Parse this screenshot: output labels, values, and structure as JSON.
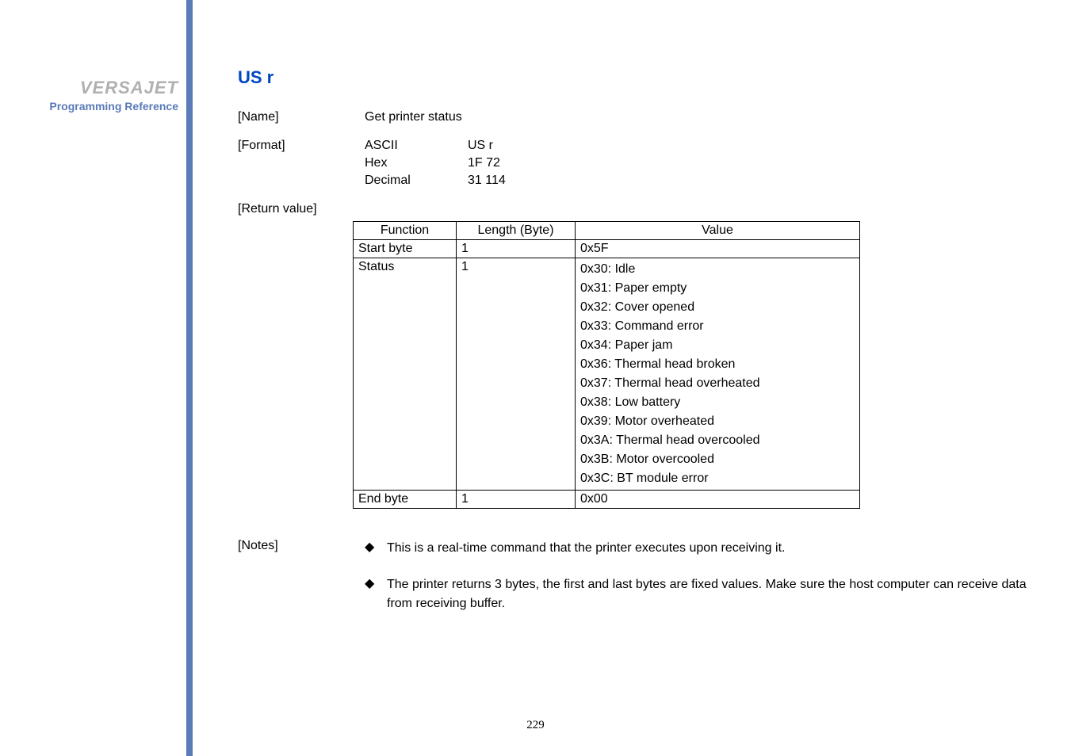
{
  "sidebar": {
    "brand": "VERSAJET",
    "subtitle": "Programming Reference"
  },
  "command": {
    "title": "US r"
  },
  "name": {
    "label": "[Name]",
    "value": "Get printer status"
  },
  "format": {
    "label": "[Format]",
    "rows": [
      {
        "enc": "ASCII",
        "val": "US r"
      },
      {
        "enc": "Hex",
        "val": "1F 72"
      },
      {
        "enc": "Decimal",
        "val": "31 114"
      }
    ]
  },
  "returnValue": {
    "label": "[Return value]",
    "headers": {
      "function": "Function",
      "length": "Length (Byte)",
      "value": "Value"
    },
    "startByte": {
      "function": "Start byte",
      "length": "1",
      "value": "0x5F"
    },
    "status": {
      "function": "Status",
      "length": "1",
      "lines": [
        "0x30: Idle",
        "0x31: Paper empty",
        "0x32: Cover opened",
        "0x33: Command error",
        "0x34: Paper jam",
        "0x36: Thermal head broken",
        "0x37: Thermal head overheated",
        "0x38: Low battery",
        "0x39: Motor overheated",
        "0x3A: Thermal head overcooled",
        "0x3B: Motor overcooled",
        "0x3C: BT module error"
      ]
    },
    "endByte": {
      "function": "End byte",
      "length": "1",
      "value": "0x00"
    }
  },
  "notes": {
    "label": "[Notes]",
    "items": [
      "This is a real-time command that the printer executes upon receiving it.",
      "The printer returns 3 bytes, the first and last bytes are fixed values. Make sure the host computer can receive data from receiving buffer."
    ]
  },
  "pageNumber": "229"
}
